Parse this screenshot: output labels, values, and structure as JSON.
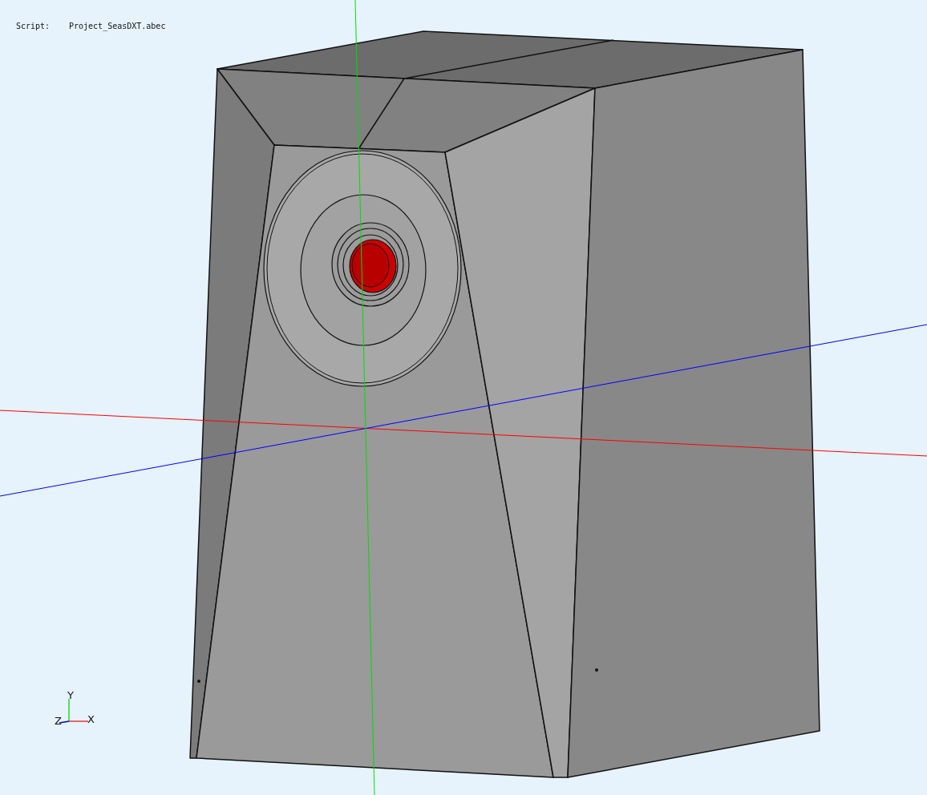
{
  "script": {
    "label": "Script:",
    "file": "Project_SeasDXT.abec"
  },
  "axis_triad": {
    "x_label": "X",
    "y_label": "Y",
    "z_label": "Z"
  }
}
